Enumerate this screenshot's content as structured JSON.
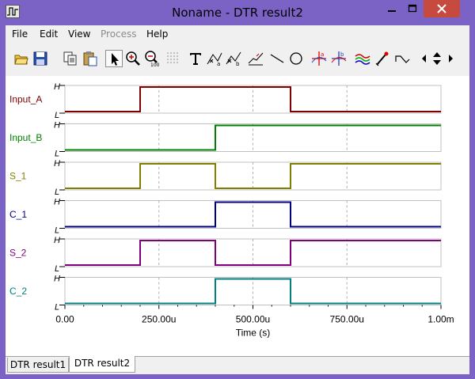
{
  "window": {
    "title": "Noname - DTR result2"
  },
  "menu": [
    {
      "label": "File",
      "enabled": true
    },
    {
      "label": "Edit",
      "enabled": true
    },
    {
      "label": "View",
      "enabled": true
    },
    {
      "label": "Process",
      "enabled": false
    },
    {
      "label": "Help",
      "enabled": true
    }
  ],
  "toolbar": [
    "open-folder-icon",
    "save-icon",
    "copy-icon",
    "paste-icon",
    "select-arrow-icon",
    "zoom-in-icon",
    "zoom-100-icon",
    "grid-icon",
    "text-tool-icon",
    "cursor-a-icon",
    "cursor-b-icon",
    "measure-icon",
    "line-icon",
    "circle-icon",
    "cursor-a-cross-icon",
    "cursor-b-cross-icon",
    "curves-icon",
    "marker-icon",
    "wave-icon",
    "nav-left-icon",
    "nav-updown-icon",
    "nav-right-icon"
  ],
  "chart_data": {
    "type": "line",
    "xlabel": "Time (s)",
    "x_ticks": [
      "0.00",
      "250.00u",
      "500.00u",
      "750.00u",
      "1.00m"
    ],
    "xlim": [
      0,
      0.001
    ],
    "level_labels": {
      "high": "H",
      "low": "L"
    },
    "series": [
      {
        "name": "Input_A",
        "color": "#800000",
        "steps": [
          [
            0,
            0
          ],
          [
            0.0002,
            1
          ],
          [
            0.0006,
            0
          ],
          [
            0.001,
            0
          ]
        ]
      },
      {
        "name": "Input_B",
        "color": "#008000",
        "steps": [
          [
            0,
            0
          ],
          [
            0.0004,
            1
          ],
          [
            0.001,
            1
          ]
        ]
      },
      {
        "name": "S_1",
        "color": "#808000",
        "steps": [
          [
            0,
            0
          ],
          [
            0.0002,
            1
          ],
          [
            0.0004,
            0
          ],
          [
            0.0006,
            1
          ],
          [
            0.001,
            1
          ]
        ]
      },
      {
        "name": "C_1",
        "color": "#000080",
        "steps": [
          [
            0,
            0
          ],
          [
            0.0004,
            1
          ],
          [
            0.0006,
            0
          ],
          [
            0.001,
            0
          ]
        ]
      },
      {
        "name": "S_2",
        "color": "#800080",
        "steps": [
          [
            0,
            0
          ],
          [
            0.0002,
            1
          ],
          [
            0.0004,
            0
          ],
          [
            0.0006,
            1
          ],
          [
            0.001,
            1
          ]
        ]
      },
      {
        "name": "C_2",
        "color": "#008080",
        "steps": [
          [
            0,
            0
          ],
          [
            0.0004,
            1
          ],
          [
            0.0006,
            0
          ],
          [
            0.001,
            0
          ]
        ]
      }
    ]
  },
  "tabs": [
    {
      "label": "DTR result1",
      "active": false
    },
    {
      "label": "DTR result2",
      "active": true
    }
  ]
}
